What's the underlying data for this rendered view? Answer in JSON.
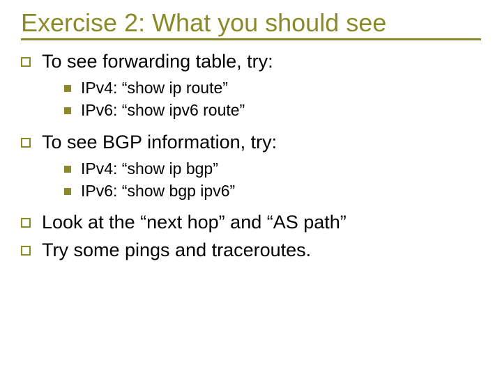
{
  "title": "Exercise 2: What you should see",
  "items": [
    {
      "text": "To see forwarding table, try:",
      "sub": [
        "IPv4: “show ip route”",
        "IPv6: “show ipv6 route”"
      ]
    },
    {
      "text": "To see BGP information, try:",
      "sub": [
        "IPv4: “show ip bgp”",
        "IPv6: “show bgp ipv6”"
      ]
    },
    {
      "text": "Look at the “next hop” and “AS path”",
      "sub": []
    },
    {
      "text": "Try some pings and traceroutes.",
      "sub": []
    }
  ]
}
